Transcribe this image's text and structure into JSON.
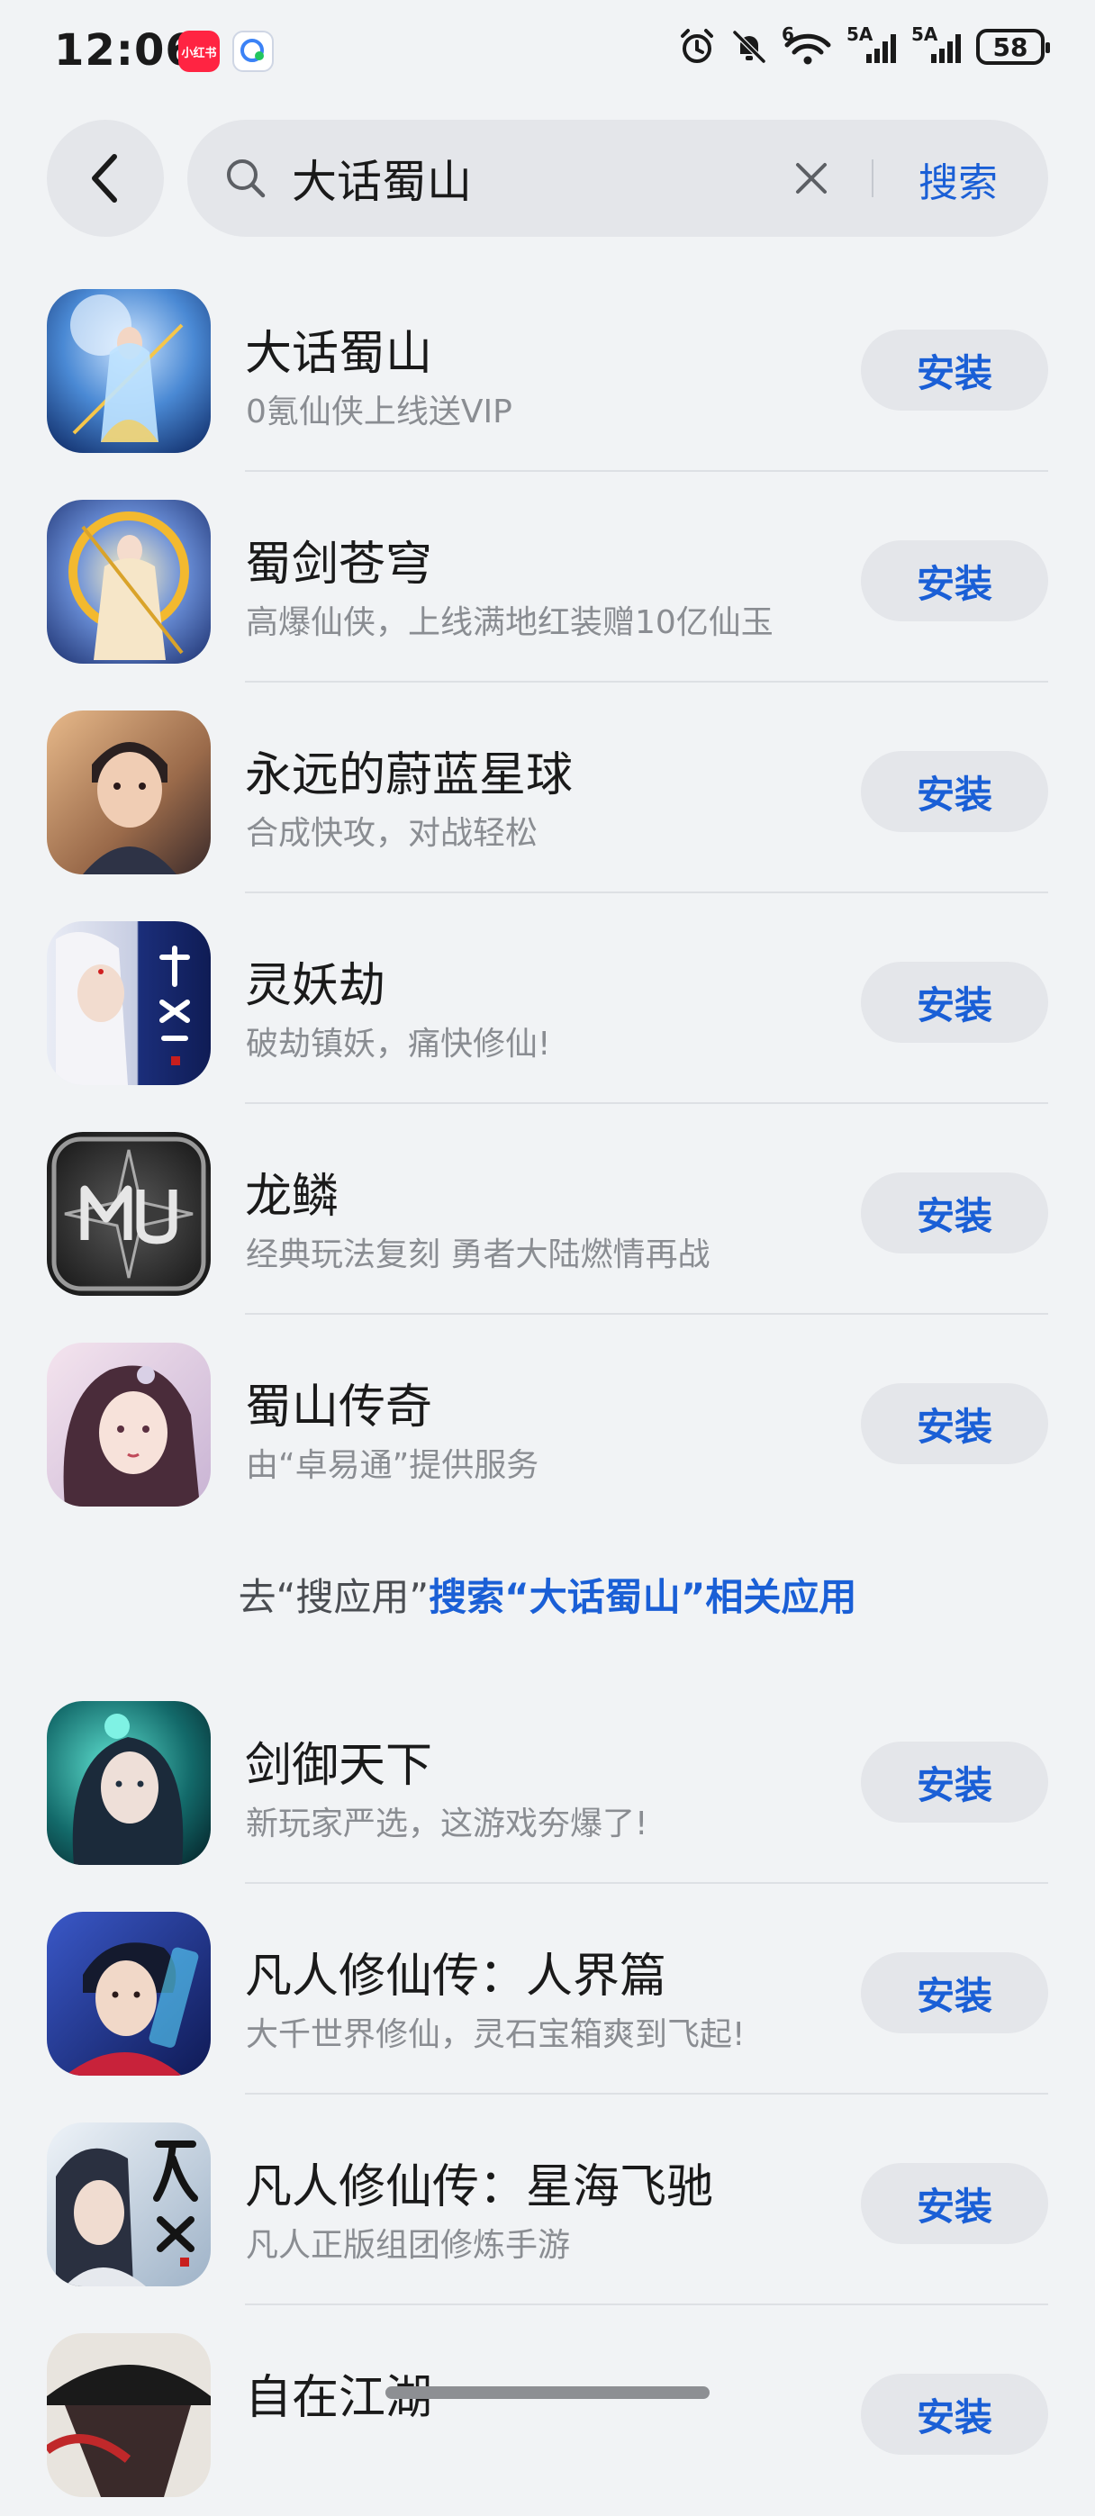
{
  "status_bar": {
    "time": "12:06",
    "notification_badge": "小红书",
    "network_1": "6",
    "network_2": "5A",
    "network_3": "5A",
    "battery": "58"
  },
  "search": {
    "query": "大话蜀山",
    "submit_label": "搜索"
  },
  "apps_primary": [
    {
      "name": "大话蜀山",
      "desc": "0氪仙侠上线送VIP",
      "install": "安装"
    },
    {
      "name": "蜀剑苍穹",
      "desc": "高爆仙侠，上线满地红装赠10亿仙玉",
      "install": "安装"
    },
    {
      "name": "永远的蔚蓝星球",
      "desc": "合成快攻，对战轻松",
      "install": "安装"
    },
    {
      "name": "灵妖劫",
      "desc": "破劫镇妖，痛快修仙!",
      "install": "安装"
    },
    {
      "name": "龙鳞",
      "desc": "经典玩法复刻 勇者大陆燃情再战",
      "install": "安装"
    },
    {
      "name": "蜀山传奇",
      "desc": "由“卓易通”提供服务",
      "install": "安装"
    }
  ],
  "search_more": {
    "prefix": "去“搜应用”",
    "link": "搜索“大话蜀山”相关应用"
  },
  "apps_secondary": [
    {
      "name": "剑御天下",
      "desc": "新玩家严选，这游戏夯爆了!",
      "install": "安装"
    },
    {
      "name": "凡人修仙传：人界篇",
      "desc": "大千世界修仙，灵石宝箱爽到飞起!",
      "install": "安装"
    },
    {
      "name": "凡人修仙传：星海飞驰",
      "desc": "凡人正版组团修炼手游",
      "install": "安装"
    },
    {
      "name": "自在江湖",
      "desc": "",
      "install": "安装"
    }
  ],
  "icon_art": {
    "icon_1": "lady-with-spear-art",
    "icon_2": "golden-ring-warrior-art",
    "icon_3": "young-man-portrait-art",
    "icon_4": "white-hair-lady-calligraphy-art",
    "icon_5": "mu-logo-emblem",
    "icon_6": "lady-portrait-art",
    "icon_7": "green-lady-art",
    "icon_8": "blue-swordsman-art",
    "icon_9": "silver-swordsman-calligraphy-art",
    "icon_10": "straw-hat-swordsman-art"
  },
  "colors": {
    "accent": "#1a5fd6",
    "background": "#f1f3f5",
    "button_bg": "#e4e6ea"
  }
}
